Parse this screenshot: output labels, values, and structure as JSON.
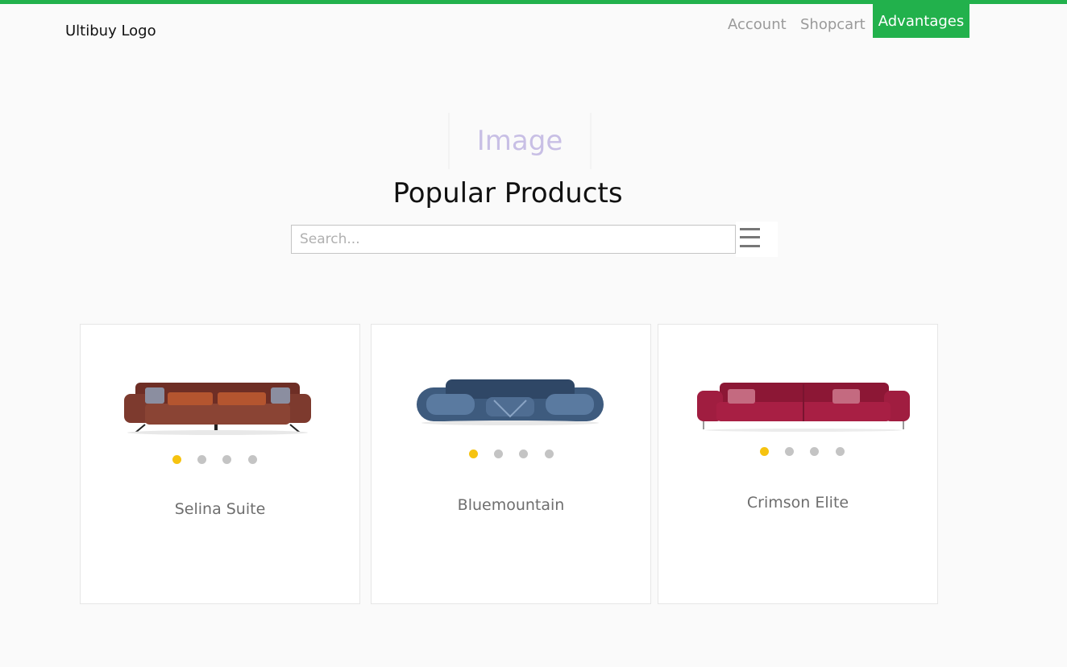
{
  "header": {
    "logo": "Ultibuy Logo",
    "nav": {
      "account": "Account",
      "shopcart": "Shopcart",
      "advantages": "Advantages"
    }
  },
  "hero": {
    "image_placeholder": "Image",
    "title": "Popular Products"
  },
  "search": {
    "placeholder": "Search...",
    "value": "",
    "menu_icon": "hamburger-menu-icon"
  },
  "colors": {
    "accent": "#22b14c",
    "active_dot": "#f6c310",
    "inactive_dot": "#c4c4c4"
  },
  "products": [
    {
      "name": "Selina Suite",
      "image": "brown-sofa",
      "color": "#7a3a2e",
      "dots": 4,
      "active_dot": 1
    },
    {
      "name": "Bluemountain",
      "image": "denim-blue-sofa",
      "color": "#3e5b7e",
      "dots": 4,
      "active_dot": 1
    },
    {
      "name": "Crimson Elite",
      "image": "crimson-sofa",
      "color": "#9e1a3d",
      "dots": 4,
      "active_dot": 1
    }
  ]
}
